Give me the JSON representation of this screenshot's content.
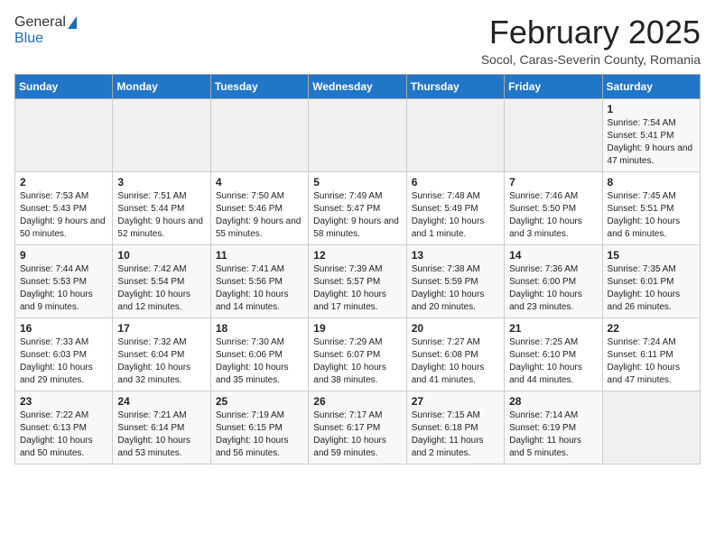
{
  "header": {
    "logo_general": "General",
    "logo_blue": "Blue",
    "month_title": "February 2025",
    "location": "Socol, Caras-Severin County, Romania"
  },
  "weekdays": [
    "Sunday",
    "Monday",
    "Tuesday",
    "Wednesday",
    "Thursday",
    "Friday",
    "Saturday"
  ],
  "weeks": [
    [
      {
        "day": "",
        "info": ""
      },
      {
        "day": "",
        "info": ""
      },
      {
        "day": "",
        "info": ""
      },
      {
        "day": "",
        "info": ""
      },
      {
        "day": "",
        "info": ""
      },
      {
        "day": "",
        "info": ""
      },
      {
        "day": "1",
        "info": "Sunrise: 7:54 AM\nSunset: 5:41 PM\nDaylight: 9 hours and 47 minutes."
      }
    ],
    [
      {
        "day": "2",
        "info": "Sunrise: 7:53 AM\nSunset: 5:43 PM\nDaylight: 9 hours and 50 minutes."
      },
      {
        "day": "3",
        "info": "Sunrise: 7:51 AM\nSunset: 5:44 PM\nDaylight: 9 hours and 52 minutes."
      },
      {
        "day": "4",
        "info": "Sunrise: 7:50 AM\nSunset: 5:46 PM\nDaylight: 9 hours and 55 minutes."
      },
      {
        "day": "5",
        "info": "Sunrise: 7:49 AM\nSunset: 5:47 PM\nDaylight: 9 hours and 58 minutes."
      },
      {
        "day": "6",
        "info": "Sunrise: 7:48 AM\nSunset: 5:49 PM\nDaylight: 10 hours and 1 minute."
      },
      {
        "day": "7",
        "info": "Sunrise: 7:46 AM\nSunset: 5:50 PM\nDaylight: 10 hours and 3 minutes."
      },
      {
        "day": "8",
        "info": "Sunrise: 7:45 AM\nSunset: 5:51 PM\nDaylight: 10 hours and 6 minutes."
      }
    ],
    [
      {
        "day": "9",
        "info": "Sunrise: 7:44 AM\nSunset: 5:53 PM\nDaylight: 10 hours and 9 minutes."
      },
      {
        "day": "10",
        "info": "Sunrise: 7:42 AM\nSunset: 5:54 PM\nDaylight: 10 hours and 12 minutes."
      },
      {
        "day": "11",
        "info": "Sunrise: 7:41 AM\nSunset: 5:56 PM\nDaylight: 10 hours and 14 minutes."
      },
      {
        "day": "12",
        "info": "Sunrise: 7:39 AM\nSunset: 5:57 PM\nDaylight: 10 hours and 17 minutes."
      },
      {
        "day": "13",
        "info": "Sunrise: 7:38 AM\nSunset: 5:59 PM\nDaylight: 10 hours and 20 minutes."
      },
      {
        "day": "14",
        "info": "Sunrise: 7:36 AM\nSunset: 6:00 PM\nDaylight: 10 hours and 23 minutes."
      },
      {
        "day": "15",
        "info": "Sunrise: 7:35 AM\nSunset: 6:01 PM\nDaylight: 10 hours and 26 minutes."
      }
    ],
    [
      {
        "day": "16",
        "info": "Sunrise: 7:33 AM\nSunset: 6:03 PM\nDaylight: 10 hours and 29 minutes."
      },
      {
        "day": "17",
        "info": "Sunrise: 7:32 AM\nSunset: 6:04 PM\nDaylight: 10 hours and 32 minutes."
      },
      {
        "day": "18",
        "info": "Sunrise: 7:30 AM\nSunset: 6:06 PM\nDaylight: 10 hours and 35 minutes."
      },
      {
        "day": "19",
        "info": "Sunrise: 7:29 AM\nSunset: 6:07 PM\nDaylight: 10 hours and 38 minutes."
      },
      {
        "day": "20",
        "info": "Sunrise: 7:27 AM\nSunset: 6:08 PM\nDaylight: 10 hours and 41 minutes."
      },
      {
        "day": "21",
        "info": "Sunrise: 7:25 AM\nSunset: 6:10 PM\nDaylight: 10 hours and 44 minutes."
      },
      {
        "day": "22",
        "info": "Sunrise: 7:24 AM\nSunset: 6:11 PM\nDaylight: 10 hours and 47 minutes."
      }
    ],
    [
      {
        "day": "23",
        "info": "Sunrise: 7:22 AM\nSunset: 6:13 PM\nDaylight: 10 hours and 50 minutes."
      },
      {
        "day": "24",
        "info": "Sunrise: 7:21 AM\nSunset: 6:14 PM\nDaylight: 10 hours and 53 minutes."
      },
      {
        "day": "25",
        "info": "Sunrise: 7:19 AM\nSunset: 6:15 PM\nDaylight: 10 hours and 56 minutes."
      },
      {
        "day": "26",
        "info": "Sunrise: 7:17 AM\nSunset: 6:17 PM\nDaylight: 10 hours and 59 minutes."
      },
      {
        "day": "27",
        "info": "Sunrise: 7:15 AM\nSunset: 6:18 PM\nDaylight: 11 hours and 2 minutes."
      },
      {
        "day": "28",
        "info": "Sunrise: 7:14 AM\nSunset: 6:19 PM\nDaylight: 11 hours and 5 minutes."
      },
      {
        "day": "",
        "info": ""
      }
    ]
  ]
}
